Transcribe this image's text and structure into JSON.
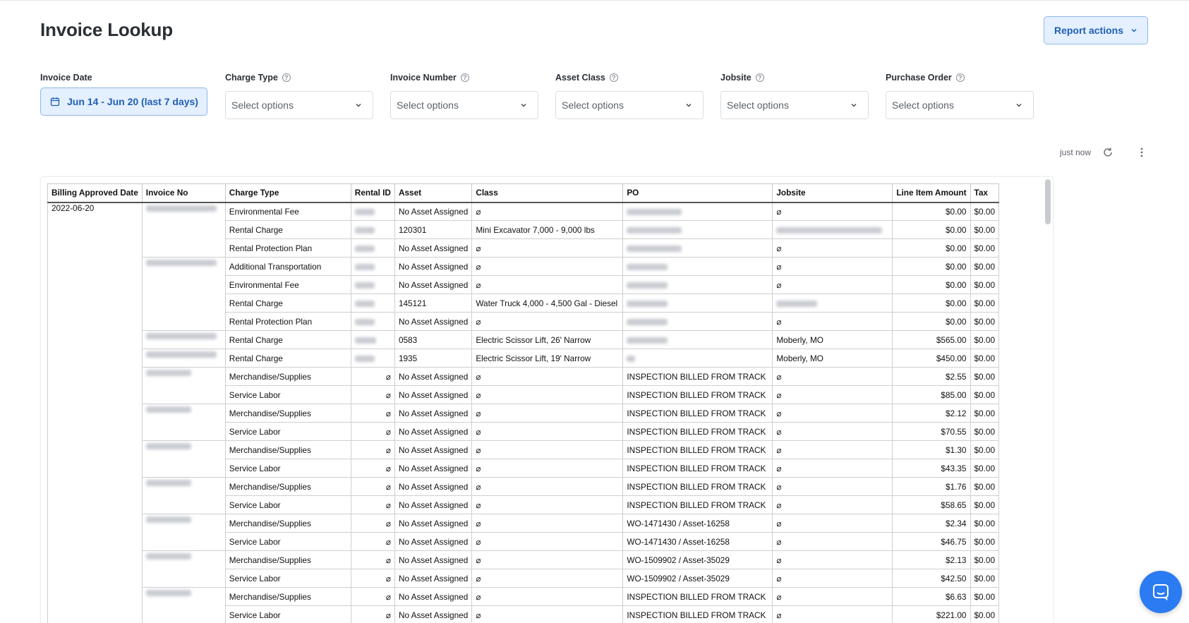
{
  "page": {
    "title": "Invoice Lookup"
  },
  "header": {
    "report_actions_label": "Report actions"
  },
  "filters": {
    "invoice_date": {
      "label": "Invoice Date",
      "value": "Jun 14 - Jun 20 (last 7 days)"
    },
    "charge_type": {
      "label": "Charge Type",
      "placeholder": "Select options"
    },
    "invoice_number": {
      "label": "Invoice Number",
      "placeholder": "Select options"
    },
    "asset_class": {
      "label": "Asset Class",
      "placeholder": "Select options"
    },
    "jobsite": {
      "label": "Jobsite",
      "placeholder": "Select options"
    },
    "purchase_order": {
      "label": "Purchase Order",
      "placeholder": "Select options"
    }
  },
  "status": {
    "updated": "just now"
  },
  "table": {
    "headers": {
      "billing_approved_date": "Billing Approved Date",
      "invoice_no": "Invoice No",
      "charge_type": "Charge Type",
      "rental_id": "Rental ID",
      "asset": "Asset",
      "class": "Class",
      "po": "PO",
      "jobsite": "Jobsite",
      "line_item_amount": "Line Item Amount",
      "tax": "Tax"
    },
    "billing_date": "2022-06-20",
    "null_symbol": "⌀",
    "rows": [
      {
        "charge_type": "Environmental Fee",
        "asset": "No Asset Assigned",
        "class": "⌀",
        "po": "",
        "jobsite": "⌀",
        "amount": "$0.00",
        "tax": "$0.00"
      },
      {
        "charge_type": "Rental Charge",
        "asset": "120301",
        "class": "Mini Excavator 7,000 - 9,000 lbs",
        "po": "",
        "jobsite": "",
        "amount": "$0.00",
        "tax": "$0.00"
      },
      {
        "charge_type": "Rental Protection Plan",
        "asset": "No Asset Assigned",
        "class": "⌀",
        "po": "",
        "jobsite": "⌀",
        "amount": "$0.00",
        "tax": "$0.00"
      },
      {
        "charge_type": "Additional Transportation",
        "asset": "No Asset Assigned",
        "class": "⌀",
        "po": "",
        "jobsite": "⌀",
        "amount": "$0.00",
        "tax": "$0.00"
      },
      {
        "charge_type": "Environmental Fee",
        "asset": "No Asset Assigned",
        "class": "⌀",
        "po": "",
        "jobsite": "⌀",
        "amount": "$0.00",
        "tax": "$0.00"
      },
      {
        "charge_type": "Rental Charge",
        "asset": "145121",
        "class": "Water Truck 4,000 - 4,500 Gal - Diesel",
        "po": "",
        "jobsite": "",
        "amount": "$0.00",
        "tax": "$0.00"
      },
      {
        "charge_type": "Rental Protection Plan",
        "asset": "No Asset Assigned",
        "class": "⌀",
        "po": "",
        "jobsite": "⌀",
        "amount": "$0.00",
        "tax": "$0.00"
      },
      {
        "charge_type": "Rental Charge",
        "asset": "0583",
        "class": "Electric Scissor Lift, 26' Narrow",
        "po": "",
        "jobsite": "Moberly, MO",
        "amount": "$565.00",
        "tax": "$0.00"
      },
      {
        "charge_type": "Rental Charge",
        "asset": "1935",
        "class": "Electric Scissor Lift, 19' Narrow",
        "po": "",
        "jobsite": "Moberly, MO",
        "amount": "$450.00",
        "tax": "$0.00"
      },
      {
        "charge_type": "Merchandise/Supplies",
        "asset": "No Asset Assigned",
        "class": "⌀",
        "po": "INSPECTION BILLED FROM TRACK",
        "jobsite": "⌀",
        "amount": "$2.55",
        "tax": "$0.00"
      },
      {
        "charge_type": "Service Labor",
        "asset": "No Asset Assigned",
        "class": "⌀",
        "po": "INSPECTION BILLED FROM TRACK",
        "jobsite": "⌀",
        "amount": "$85.00",
        "tax": "$0.00"
      },
      {
        "charge_type": "Merchandise/Supplies",
        "asset": "No Asset Assigned",
        "class": "⌀",
        "po": "INSPECTION BILLED FROM TRACK",
        "jobsite": "⌀",
        "amount": "$2.12",
        "tax": "$0.00"
      },
      {
        "charge_type": "Service Labor",
        "asset": "No Asset Assigned",
        "class": "⌀",
        "po": "INSPECTION BILLED FROM TRACK",
        "jobsite": "⌀",
        "amount": "$70.55",
        "tax": "$0.00"
      },
      {
        "charge_type": "Merchandise/Supplies",
        "asset": "No Asset Assigned",
        "class": "⌀",
        "po": "INSPECTION BILLED FROM TRACK",
        "jobsite": "⌀",
        "amount": "$1.30",
        "tax": "$0.00"
      },
      {
        "charge_type": "Service Labor",
        "asset": "No Asset Assigned",
        "class": "⌀",
        "po": "INSPECTION BILLED FROM TRACK",
        "jobsite": "⌀",
        "amount": "$43.35",
        "tax": "$0.00"
      },
      {
        "charge_type": "Merchandise/Supplies",
        "asset": "No Asset Assigned",
        "class": "⌀",
        "po": "INSPECTION BILLED FROM TRACK",
        "jobsite": "⌀",
        "amount": "$1.76",
        "tax": "$0.00"
      },
      {
        "charge_type": "Service Labor",
        "asset": "No Asset Assigned",
        "class": "⌀",
        "po": "INSPECTION BILLED FROM TRACK",
        "jobsite": "⌀",
        "amount": "$58.65",
        "tax": "$0.00"
      },
      {
        "charge_type": "Merchandise/Supplies",
        "asset": "No Asset Assigned",
        "class": "⌀",
        "po": "WO-1471430 / Asset-16258",
        "jobsite": "⌀",
        "amount": "$2.34",
        "tax": "$0.00"
      },
      {
        "charge_type": "Service Labor",
        "asset": "No Asset Assigned",
        "class": "⌀",
        "po": "WO-1471430 / Asset-16258",
        "jobsite": "⌀",
        "amount": "$46.75",
        "tax": "$0.00"
      },
      {
        "charge_type": "Merchandise/Supplies",
        "asset": "No Asset Assigned",
        "class": "⌀",
        "po": "WO-1509902 / Asset-35029",
        "jobsite": "⌀",
        "amount": "$2.13",
        "tax": "$0.00"
      },
      {
        "charge_type": "Service Labor",
        "asset": "No Asset Assigned",
        "class": "⌀",
        "po": "WO-1509902 / Asset-35029",
        "jobsite": "⌀",
        "amount": "$42.50",
        "tax": "$0.00"
      },
      {
        "charge_type": "Merchandise/Supplies",
        "asset": "No Asset Assigned",
        "class": "⌀",
        "po": "INSPECTION BILLED FROM TRACK",
        "jobsite": "⌀",
        "amount": "$6.63",
        "tax": "$0.00"
      },
      {
        "charge_type": "Service Labor",
        "asset": "No Asset Assigned",
        "class": "⌀",
        "po": "INSPECTION BILLED FROM TRACK",
        "jobsite": "⌀",
        "amount": "$221.00",
        "tax": "$0.00"
      }
    ]
  },
  "colors": {
    "accent": "#1f5fb4",
    "accent_bg": "#e4efff",
    "chat": "#2b7bf2"
  },
  "icons": {
    "calendar": "calendar-icon",
    "chevron": "chevron-down-icon",
    "help": "help-icon",
    "refresh": "refresh-icon",
    "more": "more-vertical-icon",
    "chat": "chat-icon"
  }
}
